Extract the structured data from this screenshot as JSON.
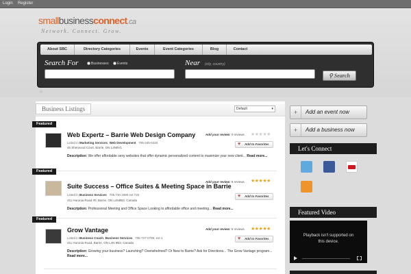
{
  "topbar": {
    "login": "Login",
    "register": "Register"
  },
  "logo": {
    "part1": "small",
    "part2": "business",
    "part3": "connect",
    "part4": ".ca",
    "tagline": "Network. Connect. Grow."
  },
  "nav": [
    "About SBC",
    "Directory Categories",
    "Events",
    "Event Categories",
    "Blog",
    "Contact"
  ],
  "search": {
    "search_for": "Search For",
    "opt_businesses": "Businesses",
    "opt_events": "Events",
    "near": "Near",
    "near_hint": "(city, country)",
    "button": "Search"
  },
  "listings": {
    "title": "Business Listings",
    "sort_value": "Default",
    "ribbon": "Featured",
    "add_review": "Add your review:",
    "favorites": "Add to Favorites",
    "listed_in": "Listed in",
    "description_label": "Description:",
    "read_more": "Read more...",
    "items": [
      {
        "title": "Web Expertz – Barrie Web Design Company",
        "reviews": "0 reviews",
        "cat1": "Marketing Services",
        "cat2": "Web Development",
        "phone": "705-345-6440",
        "address": "46 Sherwood Court, Barrie, ON L4N8V1",
        "description": "We offer affordable sexy websites that offer dynamic personalized content to maximize your new client...",
        "rating": 0
      },
      {
        "title": "Suite Success – Office Suites & Meeting Space in Barrie",
        "reviews": "5 reviews",
        "cat1": "Business Services",
        "cat2": "",
        "phone": "705.730.1999 ext 725",
        "address": "411 Huronia Road #0, Barrie, ON L4N9B3, Canada",
        "description": "Professional Meeting and Office Space Looking to affordable office and meeting...",
        "rating": 5
      },
      {
        "title": "Grow Vantage",
        "reviews": "5 reviews",
        "cat1": "Business Coach",
        "cat2": "Business Services",
        "phone": "705-727-0789, ext 1",
        "address": "411 Huronia Road, Barrie, ON L4N 9B3, Canada",
        "description": "Growing your business? Launching? Overwhelmed? Or New to Barrie? Ask for Directions... The Grow Vantage program...",
        "rating": 5
      }
    ]
  },
  "sidebar": {
    "add_event": "Add an event now",
    "add_business": "Add a business now",
    "lets_connect": "Let's Connect",
    "social": [
      "twitter",
      "facebook",
      "youtube",
      "rss"
    ],
    "featured_video": "Featured Video",
    "video_msg_line1": "Playback isn't supported on",
    "video_msg_line2": "this device."
  },
  "colors": {
    "brand_orange": "#e0642a",
    "star_gold": "#e8a317",
    "twitter_blue": "#5ea9dd",
    "facebook_blue": "#3b5998",
    "youtube_red": "#cc181e",
    "rss_orange": "#f0932b"
  }
}
